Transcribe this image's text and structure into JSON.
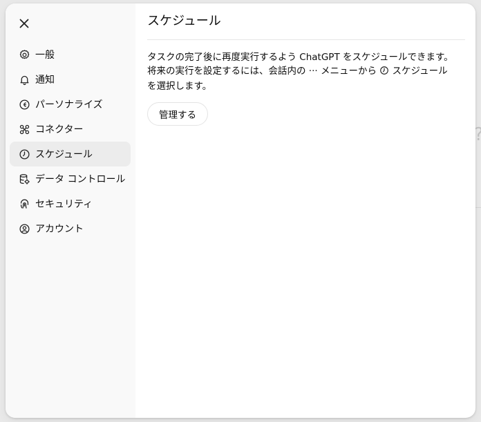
{
  "dialog": {
    "close_label": "×"
  },
  "sidebar": {
    "items": [
      {
        "label": "一般",
        "icon": "gear-icon",
        "active": false
      },
      {
        "label": "通知",
        "icon": "bell-icon",
        "active": false
      },
      {
        "label": "パーソナライズ",
        "icon": "personalize-icon",
        "active": false
      },
      {
        "label": "コネクター",
        "icon": "connector-icon",
        "active": false
      },
      {
        "label": "スケジュール",
        "icon": "clock-icon",
        "active": true
      },
      {
        "label": "データ コントロール",
        "icon": "database-icon",
        "active": false
      },
      {
        "label": "セキュリティ",
        "icon": "fingerprint-icon",
        "active": false
      },
      {
        "label": "アカウント",
        "icon": "user-circle-icon",
        "active": false
      }
    ]
  },
  "main": {
    "title": "スケジュール",
    "desc_line1": "タスクの完了後に再度実行するよう ChatGPT をスケジュールできます。",
    "desc_line2a": "将来の実行を設定するには、会話内の ··· メニューから ",
    "desc_line2b": " スケジュール",
    "desc_line3": "を選択します。",
    "manage_button": "管理する"
  },
  "background": {
    "edge_glyph": "?"
  }
}
